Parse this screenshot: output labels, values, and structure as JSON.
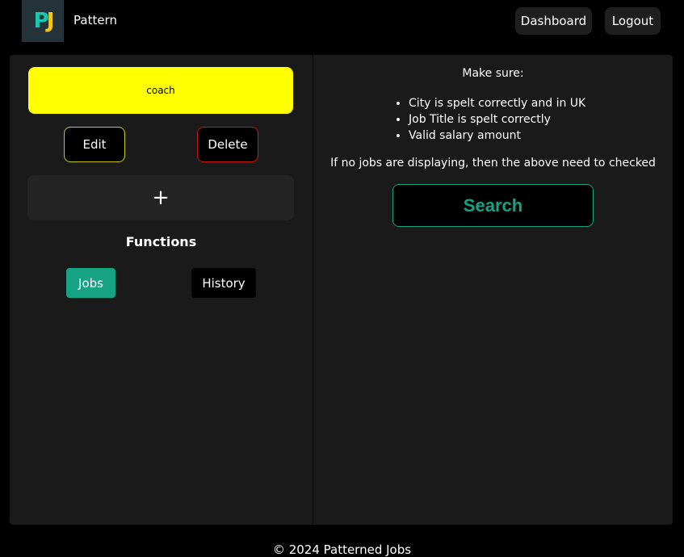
{
  "header": {
    "logo_text_p": "P",
    "logo_text_j": "J",
    "brand": "Pattern",
    "nav": {
      "dashboard": "Dashboard",
      "logout": "Logout"
    }
  },
  "left_panel": {
    "profile_name": "coach",
    "edit_label": "Edit",
    "delete_label": "Delete",
    "add_icon": "+",
    "functions_title": "Functions",
    "functions": {
      "jobs": "Jobs",
      "history": "History"
    }
  },
  "right_panel": {
    "heading": "Make sure:",
    "checklist": [
      "City is spelt correctly and in UK",
      "Job Title is spelt correctly",
      "Valid salary amount"
    ],
    "hint": "If no jobs are displaying, then the above need to checked",
    "search_label": "Search"
  },
  "footer": {
    "text": "© 2024 Patterned Jobs"
  },
  "colors": {
    "accent": "#15a383",
    "profile_card": "#ffff00",
    "edit_border": "#c9c61a",
    "delete_border": "#d11414",
    "panel_bg": "#1a1a1a"
  },
  "icons": {
    "add": "plus-icon"
  }
}
